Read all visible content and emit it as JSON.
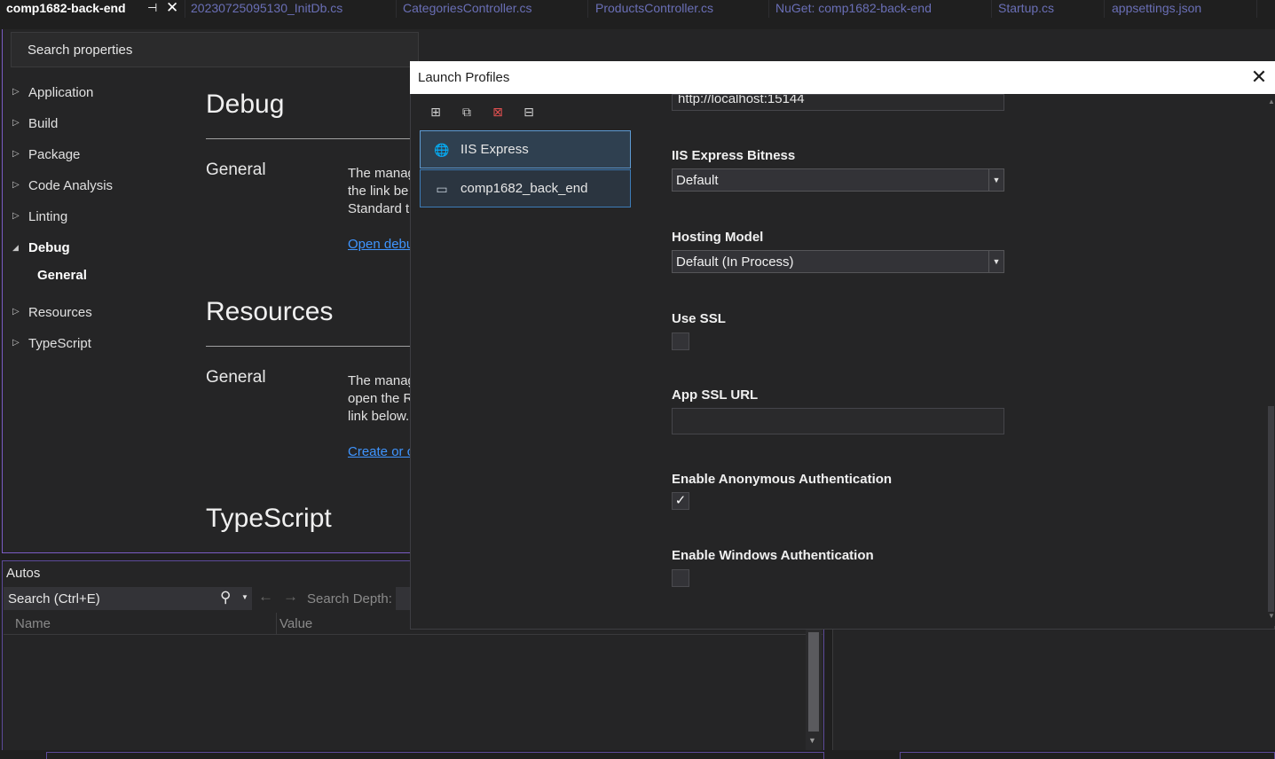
{
  "tabs": [
    {
      "label": "comp1682-back-end",
      "active": true
    },
    {
      "label": "20230725095130_InitDb.cs"
    },
    {
      "label": "CategoriesController.cs"
    },
    {
      "label": "ProductsController.cs"
    },
    {
      "label": "NuGet: comp1682-back-end"
    },
    {
      "label": "Startup.cs"
    },
    {
      "label": "appsettings.json"
    }
  ],
  "search_properties": "Search properties",
  "nav": [
    {
      "label": "Application",
      "expanded": false
    },
    {
      "label": "Build",
      "expanded": false
    },
    {
      "label": "Package",
      "expanded": false
    },
    {
      "label": "Code Analysis",
      "expanded": false
    },
    {
      "label": "Linting",
      "expanded": false
    },
    {
      "label": "Debug",
      "expanded": true
    },
    {
      "label": "General",
      "sub": true
    },
    {
      "label": "Resources",
      "expanded": false
    },
    {
      "label": "TypeScript",
      "expanded": false
    }
  ],
  "content": {
    "debug_title": "Debug",
    "debug_general": "General",
    "debug_desc": [
      "The manag",
      "the link be",
      "Standard t"
    ],
    "debug_link": "Open debu",
    "resources_title": "Resources",
    "resources_general": "General",
    "resources_desc": [
      "The manag",
      "open the R",
      "link below."
    ],
    "resources_link": "Create or c",
    "typescript_title": "TypeScript"
  },
  "autos": {
    "title": "Autos",
    "search": "Search (Ctrl+E)",
    "search_depth": "Search Depth:",
    "col_name": "Name",
    "col_value": "Value"
  },
  "dialog": {
    "title": "Launch Profiles",
    "toolbar": [
      "new-profile-icon",
      "copy-profile-icon",
      "delete-profile-icon",
      "rename-profile-icon"
    ],
    "profiles": [
      {
        "label": "IIS Express",
        "selected": true,
        "icon": "iis-globe-icon"
      },
      {
        "label": "comp1682_back_end",
        "selected": false,
        "icon": "window-icon"
      }
    ],
    "app_url_value": "http://localhost:15144",
    "fields": {
      "bitness_label": "IIS Express Bitness",
      "bitness_value": "Default",
      "hosting_label": "Hosting Model",
      "hosting_value": "Default (In Process)",
      "ssl_label": "Use SSL",
      "ssl_checked": false,
      "ssl_url_label": "App SSL URL",
      "ssl_url_value": "",
      "anon_label": "Enable Anonymous Authentication",
      "anon_checked": true,
      "win_label": "Enable Windows Authentication",
      "win_checked": false
    }
  },
  "colors": {
    "background": "#1f1f1f",
    "panel": "#252526",
    "accent": "#7a5cc4",
    "link": "#3f95ff",
    "profile_border": "#3d7cb8"
  }
}
